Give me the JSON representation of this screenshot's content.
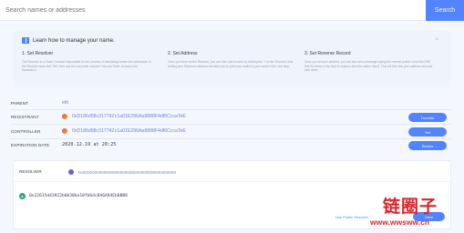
{
  "search": {
    "placeholder": "Search names or addresses",
    "button_label": "Search"
  },
  "learn": {
    "title": "Learn how to manage your name.",
    "close_label": "×",
    "steps": [
      {
        "title": "1. Set Resolver",
        "desc": "The Resolver is a Smart Contract responsible for the process of translating names into addresses. In the Resolver area click 'Set', then add the use public resolver' link and 'Save' to launch the transaction."
      },
      {
        "title": "2. Set Address",
        "desc": "Once you have set the Resolver, you can then add records by clicking the '+' in the 'Records' field. Adding your Ethereum address will allow you to point your wallet to your name in the next step."
      },
      {
        "title": "3. Set Reverse Record",
        "desc": "Once you set your address, you can also set a message saying the reverse pointer to tell the ENS that the arrow in the field to expand, then the button 'Save'. This will then link your address into your new name."
      }
    ]
  },
  "records": {
    "parent_label": "PARENT",
    "parent_value": "eth",
    "registrant_label": "REGISTRANT",
    "registrant_value": "0xD186d98c31774Zc1a01E296Aa8888F4df6CccaTeE",
    "controller_label": "CONTROLLER",
    "controller_value": "0xD186d98c31774Zc1a01E296Aa8888F4df6CccaTeE",
    "expiration_label": "EXPIRATION DATE",
    "expiration_value": "2020.12.19 at 20:25",
    "transfer_label": "Transfer",
    "set_label": "Set",
    "renew_label": "Renew"
  },
  "resolver": {
    "label": "RESOLVER",
    "value": "0x0000000000000000000000000000000000000000",
    "eth_address": "0x22615d43922b0b38ba10fb6dc8A6A94Eb0BB8",
    "public_resolver_link": "Use Public Resolver",
    "save_label": "Save"
  },
  "watermark": {
    "cn": "链圈子",
    "url": "www.wwsww.cn"
  }
}
